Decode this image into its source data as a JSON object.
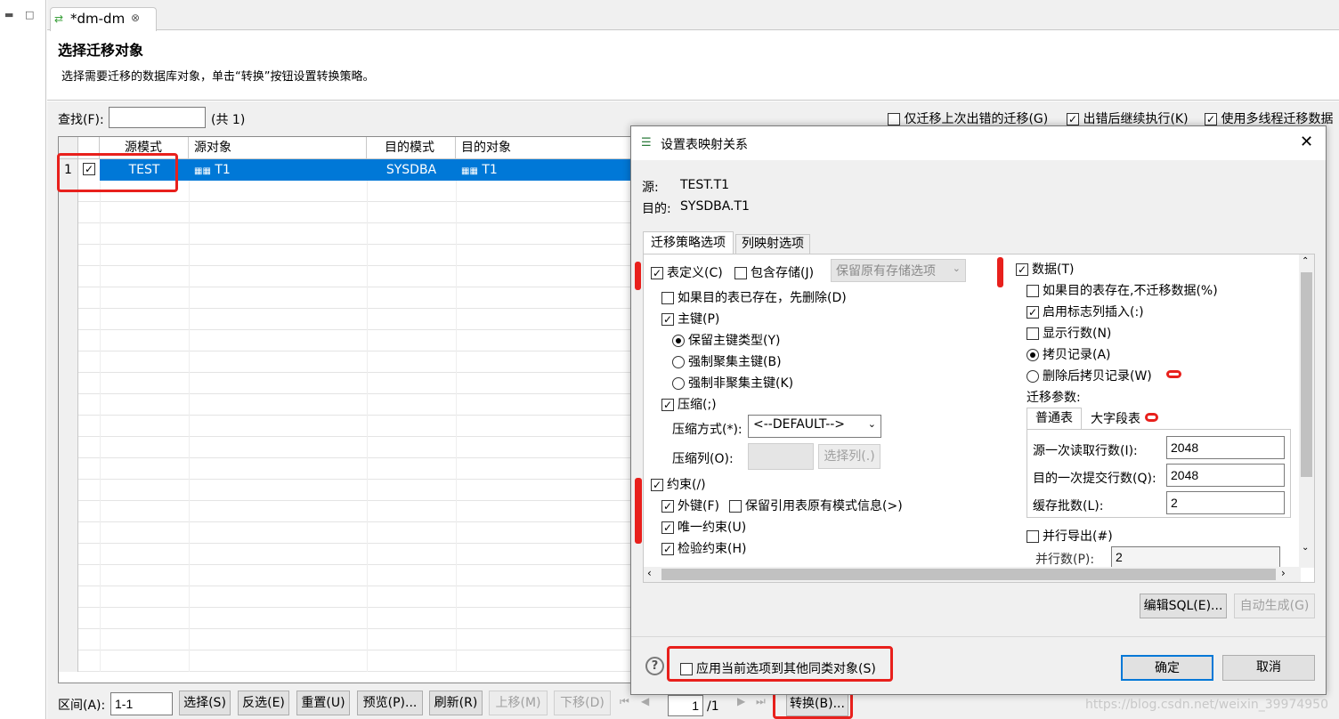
{
  "tab": {
    "title": "*dm-dm"
  },
  "header": {
    "title": "选择迁移对象",
    "desc": "选择需要迁移的数据库对象，单击“转换”按钮设置转换策略。"
  },
  "search": {
    "label": "查找(F):",
    "value": "",
    "count": "(共 1)"
  },
  "options": {
    "only_errors": "仅迁移上次出错的迁移(G)",
    "continue_on_error": "出错后继续执行(K)",
    "multithread": "使用多线程迁移数据"
  },
  "grid": {
    "columns": [
      "源模式",
      "源对象",
      "目的模式",
      "目的对象"
    ],
    "rows": [
      {
        "num": "1",
        "src_schema": "TEST",
        "src_obj": "T1",
        "dst_schema": "SYSDBA",
        "dst_obj": "T1"
      }
    ]
  },
  "bottom": {
    "range_label": "区间(A):",
    "range_value": "1-1",
    "select": "选择(S)",
    "invert": "反选(E)",
    "reset": "重置(U)",
    "preview": "预览(P)...",
    "refresh": "刷新(R)",
    "up": "上移(M)",
    "down": "下移(D)",
    "page": "1",
    "pages": "/1",
    "convert": "转换(B)..."
  },
  "dialog": {
    "title": "设置表映射关系",
    "src_label": "源:",
    "src_value": "TEST.T1",
    "dst_label": "目的:",
    "dst_value": "SYSDBA.T1",
    "tabs": [
      "迁移策略选项",
      "列映射选项"
    ],
    "left": {
      "table_def": "表定义(C)",
      "include_storage": "包含存储(J)",
      "storage_combo": "保留原有存储选项",
      "drop_if_exists": "如果目的表已存在，先删除(D)",
      "pk": "主键(P)",
      "keep_pk": "保留主键类型(Y)",
      "force_cluster": "强制聚集主键(B)",
      "force_noncluster": "强制非聚集主键(K)",
      "compress": "压缩(;)",
      "compress_mode_label": "压缩方式(*):",
      "compress_mode": "<--DEFAULT-->",
      "compress_cols_label": "压缩列(O):",
      "select_cols": "选择列(.)",
      "constraint": "约束(/)",
      "fk": "外键(F)",
      "keep_ref": "保留引用表原有模式信息(>)",
      "unique": "唯一约束(U)",
      "check": "检验约束(H)"
    },
    "right": {
      "data": "数据(T)",
      "skip_if_exists": "如果目的表存在,不迁移数据(%)",
      "identity_insert": "启用标志列插入(:)",
      "show_rows": "显示行数(N)",
      "copy": "拷贝记录(A)",
      "delete_copy": "删除后拷贝记录(W)",
      "params_label": "迁移参数:",
      "param_tabs": [
        "普通表",
        "大字段表"
      ],
      "read_rows_label": "源一次读取行数(I):",
      "read_rows": "2048",
      "commit_rows_label": "目的一次提交行数(Q):",
      "commit_rows": "2048",
      "batch_label": "缓存批数(L):",
      "batch": "2",
      "parallel_export": "并行导出(#)",
      "parallel_label": "并行数(P):",
      "parallel": "2"
    },
    "edit_sql": "编辑SQL(E)...",
    "auto_gen": "自动生成(G)",
    "apply_all": "应用当前选项到其他同类对象(S)",
    "ok": "确定",
    "cancel": "取消"
  },
  "watermark": "https://blog.csdn.net/weixin_39974950"
}
